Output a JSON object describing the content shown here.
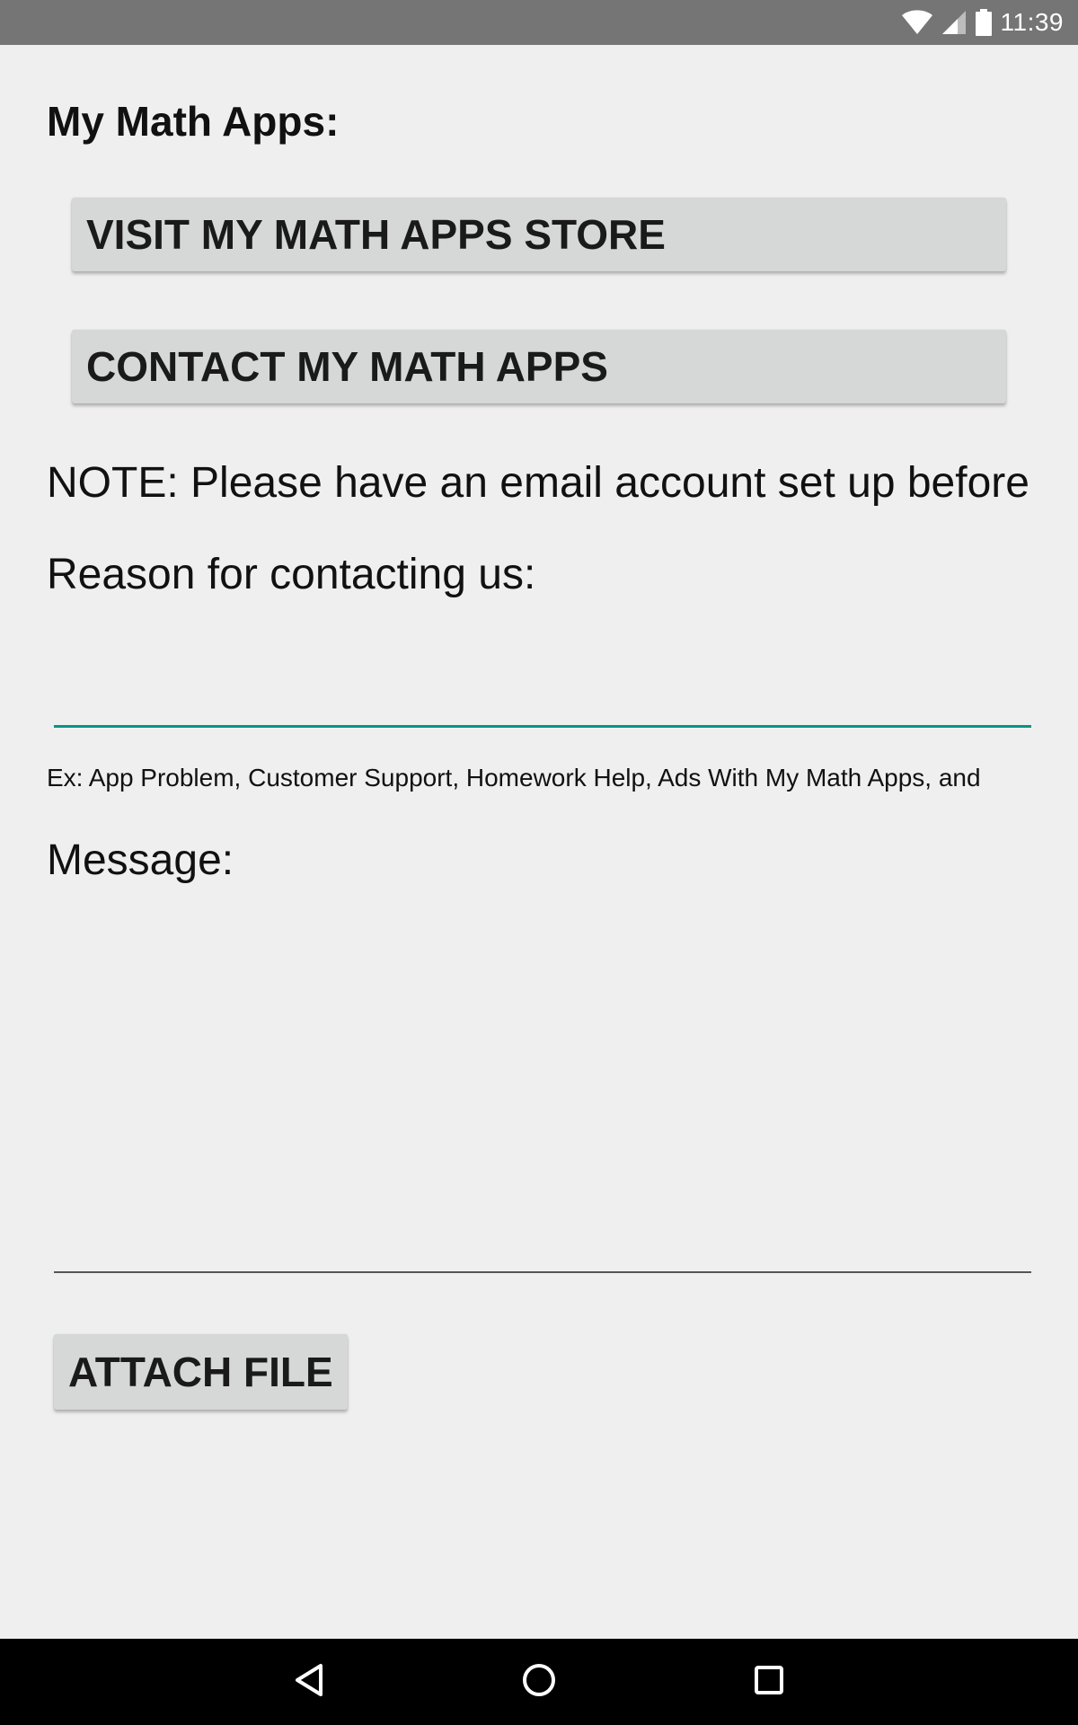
{
  "status_bar": {
    "time": "11:39",
    "icons": [
      "wifi-icon",
      "cell-signal-icon",
      "battery-icon"
    ]
  },
  "main": {
    "heading": "My Math Apps:",
    "store_button_label": "VISIT MY MATH APPS STORE",
    "contact_button_label": "CONTACT MY MATH APPS",
    "note_text": "NOTE: Please have an email account set up before",
    "reason_label": "Reason for contacting us:",
    "reason_value": "",
    "reason_hint": "Ex: App Problem, Customer Support, Homework Help, Ads With My Math Apps, and",
    "message_label": "Message:",
    "message_value": "",
    "attach_button_label": "ATTACH FILE"
  },
  "nav_bar": {
    "buttons": [
      "back-icon",
      "home-icon",
      "recents-icon"
    ]
  },
  "colors": {
    "accent": "#009688",
    "background": "#efefef",
    "button": "#d6d7d7",
    "status_bar": "#757575",
    "nav_bar": "#000000"
  }
}
